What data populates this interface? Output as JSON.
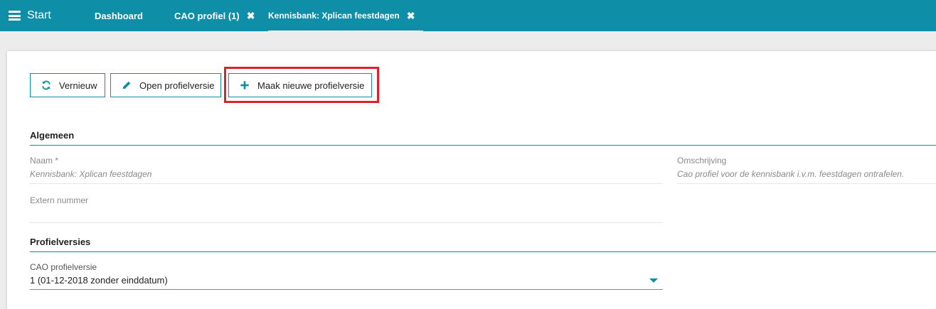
{
  "topbar": {
    "start_label": "Start",
    "menu_icon": "hamburger-icon",
    "tabs": [
      {
        "label": "Dashboard",
        "closable": false,
        "active": false
      },
      {
        "label": "CAO profiel (1)",
        "closable": true,
        "active": false
      },
      {
        "label": "Kennisbank: Xplican feestdagen",
        "closable": true,
        "active": true
      }
    ],
    "close_glyph": "✖",
    "bar_color": "#0f8ea8"
  },
  "toolbar": {
    "refresh_label": "Vernieuw",
    "refresh_icon": "refresh-icon",
    "open_label": "Open profielversie",
    "open_icon": "pencil-icon",
    "new_label": "Maak nieuwe profielversie",
    "new_icon": "plus-icon",
    "highlight_color": "#e0212a"
  },
  "algemeen": {
    "title": "Algemeen",
    "naam_label": "Naam *",
    "naam_value": "Kennisbank: Xplican feestdagen",
    "omschrijving_label": "Omschrijving",
    "omschrijving_value": "Cao profiel voor de kennisbank i.v.m. feestdagen ontrafelen.",
    "extern_label": "Extern nummer",
    "extern_value": ""
  },
  "profielversies": {
    "title": "Profielversies",
    "select_label": "CAO profielversie",
    "select_value": "1 (01-12-2018 zonder einddatum)"
  }
}
